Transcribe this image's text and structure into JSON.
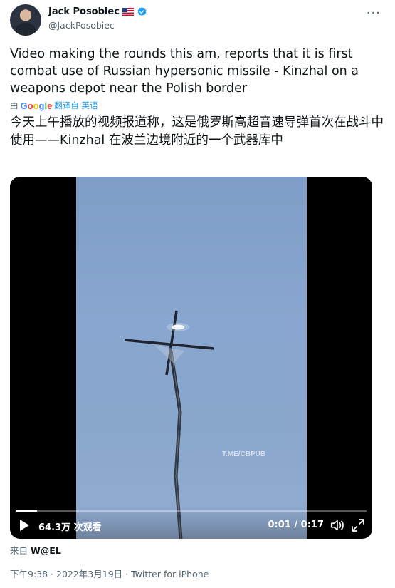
{
  "author": {
    "name": "Jack Posobiec",
    "flag": "🇺🇸",
    "handle": "@JackPosobiec"
  },
  "more_label": "···",
  "tweet": {
    "text": "Video making the rounds this am, reports that it is first combat use of Russian hypersonic missile - Kinzhal on a weapons depot near the Polish border",
    "translate_prefix": "由",
    "translate_brand": "Google",
    "translate_suffix": "翻译自 英语",
    "translated_text": "今天上午播放的视频报道称，这是俄罗斯高超音速导弹首次在战斗中使用——Kinzhal 在波兰边境附近的一个武器库中"
  },
  "video": {
    "watermark": "T.ME/CBPUB",
    "views": "64.3万 次观看",
    "time": "0:01 / 0:17",
    "progress": 0.06
  },
  "source": {
    "prefix": "来自",
    "name": "W@EL"
  },
  "meta": "下午9:38 · 2022年3月19日 · Twitter for iPhone",
  "colors": {
    "accent": "#1d9bf0",
    "muted": "#536471",
    "text": "#0f1419"
  }
}
